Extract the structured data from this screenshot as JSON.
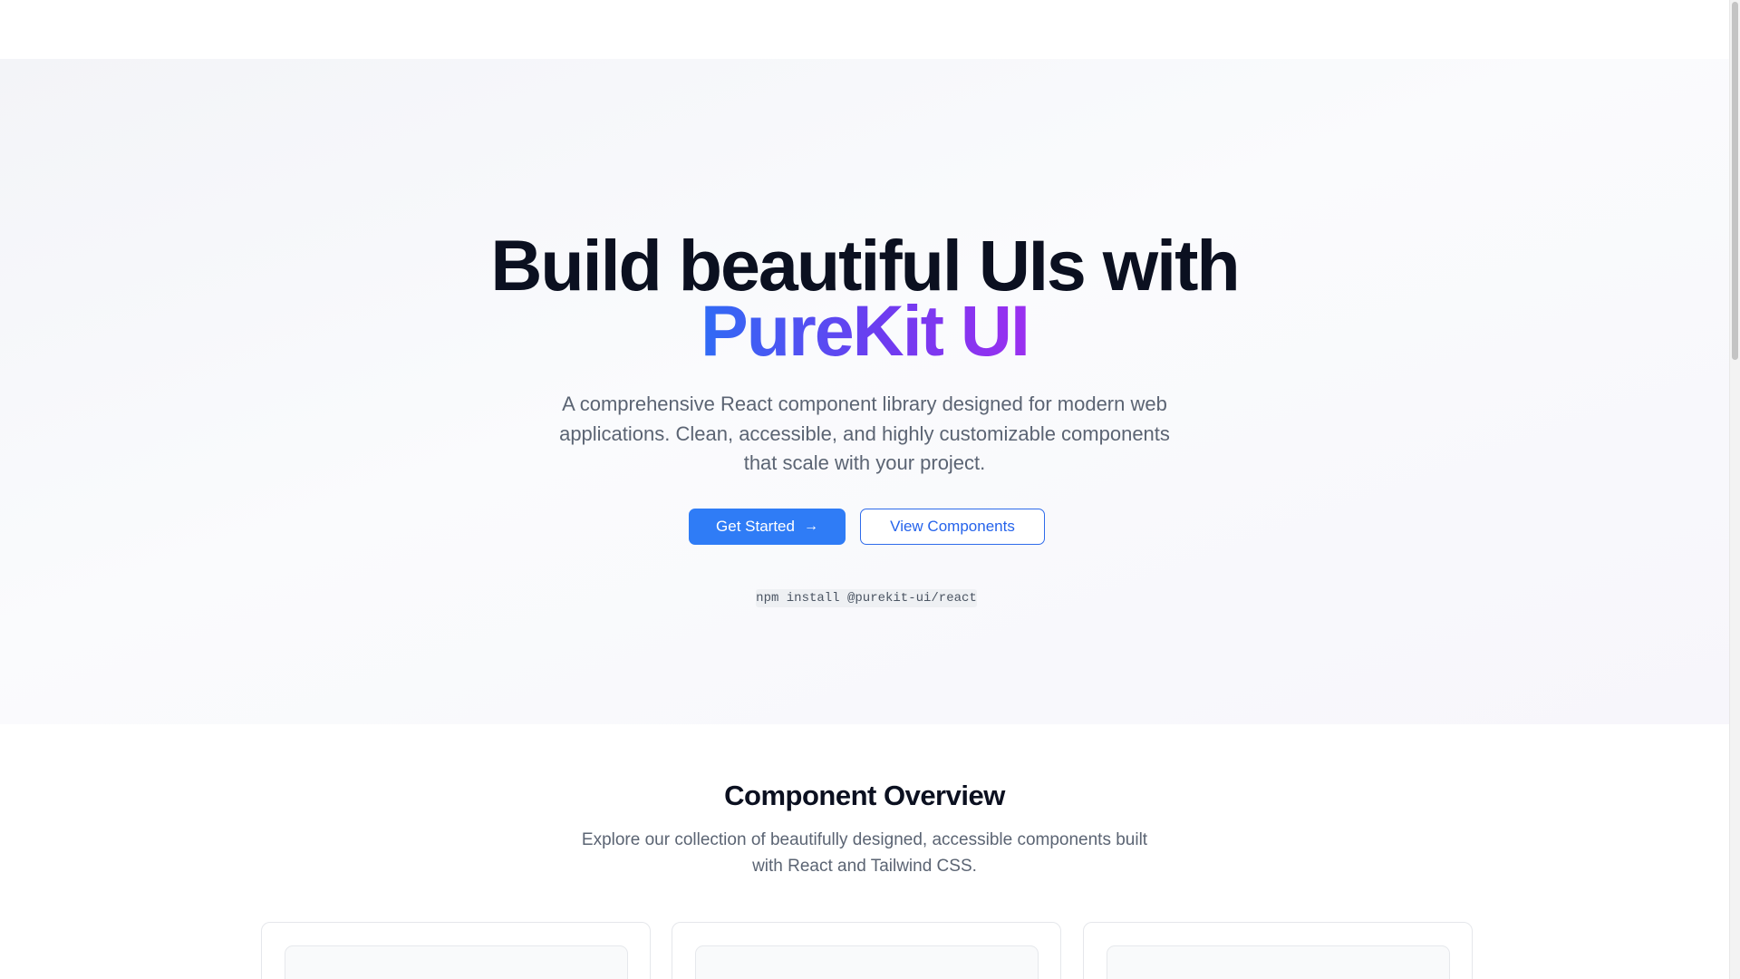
{
  "hero": {
    "title_line1": "Build beautiful UIs with",
    "title_line2": "PureKit UI",
    "subtitle": "A comprehensive React component library designed for modern web applications. Clean, accessible, and highly customizable components that scale with your project.",
    "primary_button": "Get Started",
    "primary_button_icon": "arrow-right-icon",
    "secondary_button": "View Components",
    "install_command": "npm install @purekit-ui/react"
  },
  "overview": {
    "title": "Component Overview",
    "subtitle": "Explore our collection of beautifully designed, accessible components built with React and Tailwind CSS."
  },
  "colors": {
    "primary": "#2f7cf6",
    "gradient_start": "#2f6bf5",
    "gradient_end": "#9b2ff0",
    "heading": "#0b1020",
    "muted": "#5b6473"
  }
}
